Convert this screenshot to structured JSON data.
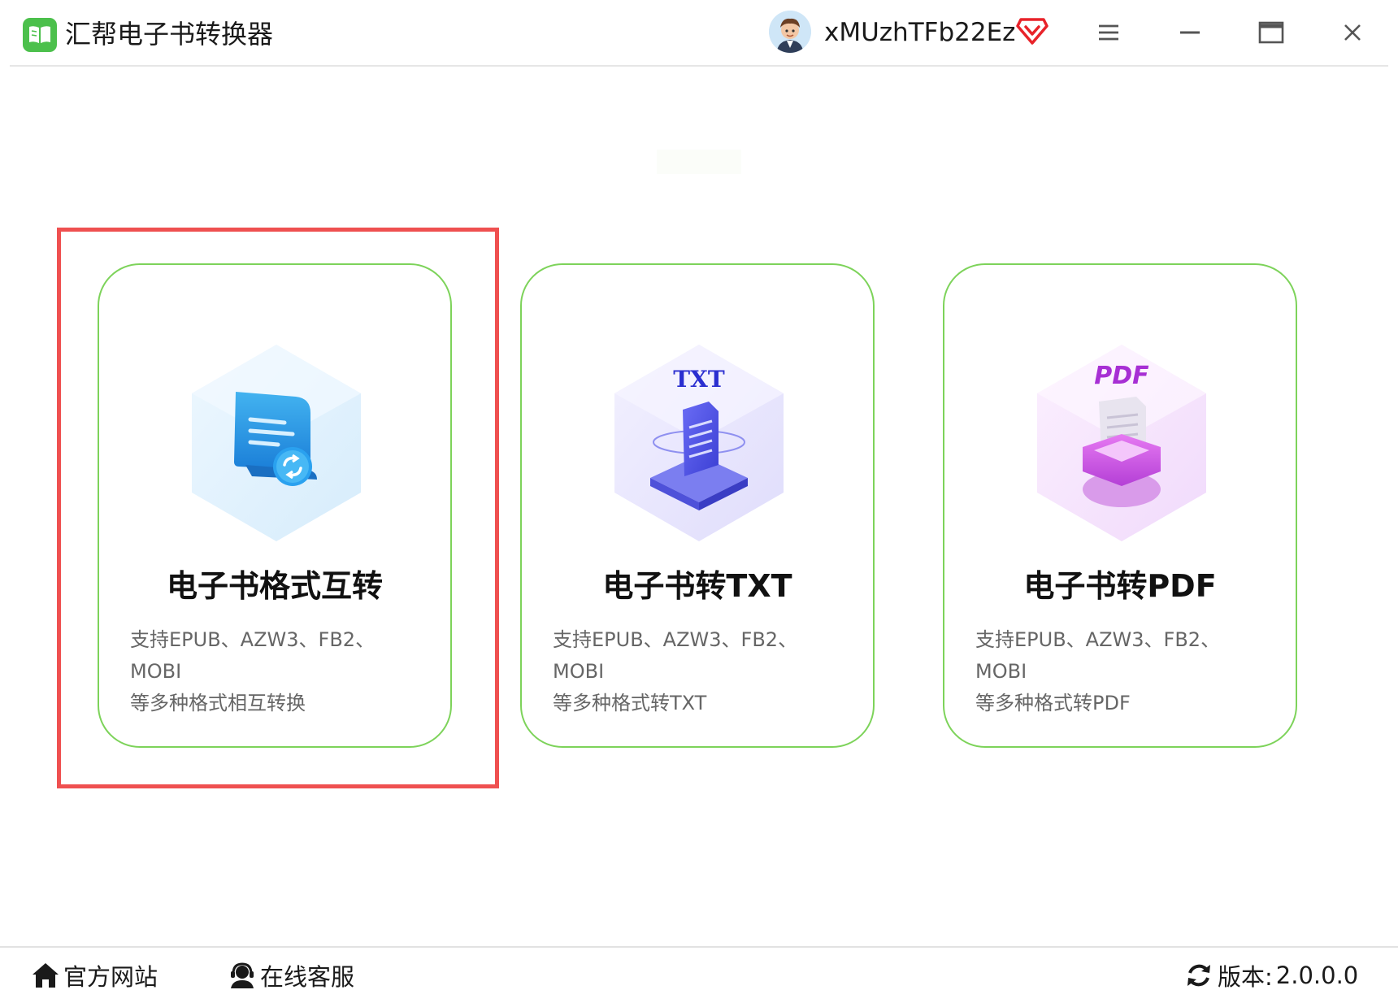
{
  "app": {
    "title": "汇帮电子书转换器"
  },
  "user": {
    "name": "xMUzhTFb22Ez"
  },
  "colors": {
    "accent": "#7dd35a",
    "logo": "#4cc04c",
    "selection": "#ef5050",
    "vip": "#e8232a"
  },
  "cards": [
    {
      "title": "电子书格式互转",
      "desc_line1": "支持EPUB、AZW3、FB2、MOBI",
      "desc_line2": "等多种格式相互转换",
      "icon": "convert-icon",
      "selected": true
    },
    {
      "title": "电子书转TXT",
      "desc_line1": "支持EPUB、AZW3、FB2、MOBI",
      "desc_line2": "等多种格式转TXT",
      "icon": "txt-icon",
      "icon_label": "TXT",
      "selected": false
    },
    {
      "title": "电子书转PDF",
      "desc_line1": "支持EPUB、AZW3、FB2、MOBI",
      "desc_line2": "等多种格式转PDF",
      "icon": "pdf-icon",
      "icon_label": "PDF",
      "selected": false
    }
  ],
  "footer": {
    "website": "官方网站",
    "service": "在线客服",
    "version_label": "版本:",
    "version_value": "2.0.0.0"
  }
}
